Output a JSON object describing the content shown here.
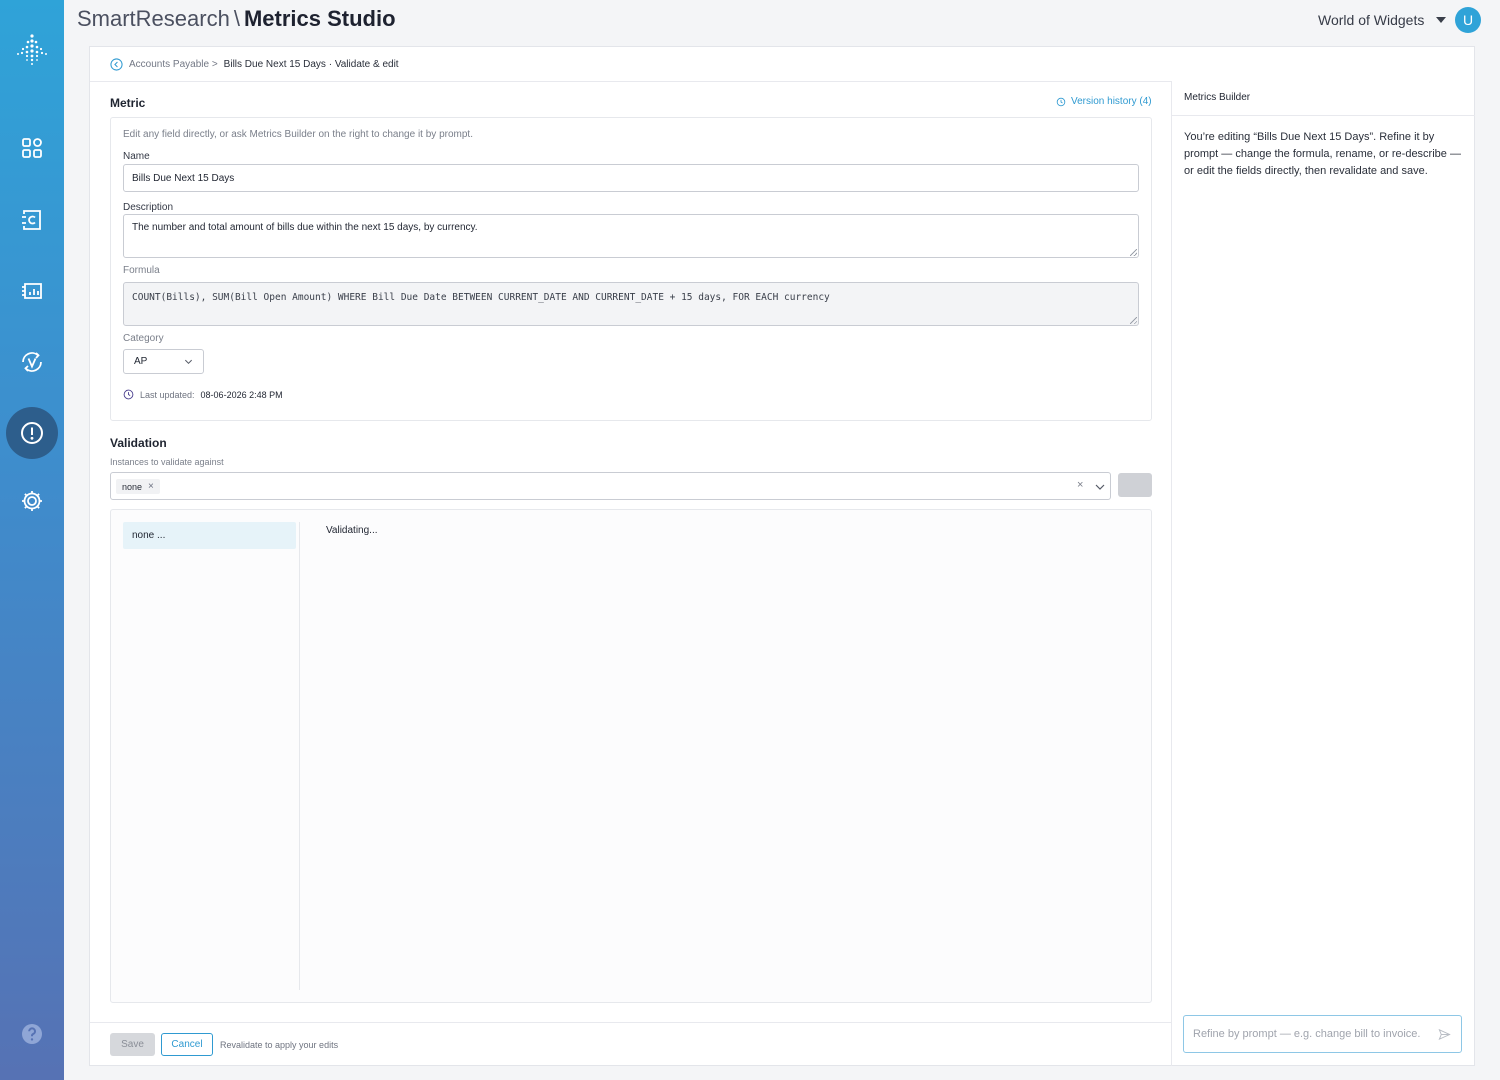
{
  "app": {
    "brand": "SmartResearch",
    "separator": "\\",
    "product": "Metrics Studio",
    "workspace": "World of Widgets",
    "avatar_initial": "U",
    "accent_color": "#2f9ad1"
  },
  "breadcrumb": {
    "parent": "Accounts Payable >",
    "current": "Bills Due Next 15 Days · Validate & edit"
  },
  "metric": {
    "section_title": "Metric",
    "version_history": "Version history (4)",
    "hint": "Edit any field directly, or ask Metrics Builder on the right to change it by prompt.",
    "name_label": "Name",
    "name_value": "Bills Due Next 15 Days",
    "description_label": "Description",
    "description_value": "The number and total amount of bills due within the next 15 days, by currency.",
    "formula_label": "Formula",
    "formula_value": "COUNT(Bills), SUM(Bill Open Amount) WHERE Bill Due Date BETWEEN CURRENT_DATE AND CURRENT_DATE + 15 days, FOR EACH currency",
    "category_label": "Category",
    "category_value": "AP",
    "last_updated_label": "Last updated:",
    "last_updated_value": "08-06-2026 2:48 PM"
  },
  "validation": {
    "section_title": "Validation",
    "instances_label": "Instances to validate against",
    "selected_chip": "none",
    "results": [
      {
        "label": "none ..."
      }
    ],
    "status": "Validating..."
  },
  "footer": {
    "save_label": "Save",
    "cancel_label": "Cancel",
    "hint": "Revalidate to apply your edits"
  },
  "builder": {
    "title": "Metrics Builder",
    "message": "You’re editing “Bills Due Next 15 Days”. Refine it by prompt — change the formula, rename, or re-describe — or edit the fields directly, then revalidate and save.",
    "prompt_placeholder": "Refine by prompt — e.g. change bill to invoice."
  }
}
